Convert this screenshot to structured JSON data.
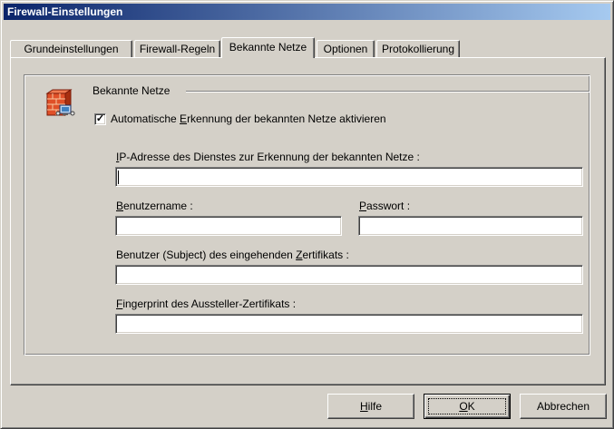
{
  "window": {
    "title": "Firewall-Einstellungen"
  },
  "tabs": [
    {
      "label": "Grundeinstellungen",
      "active": false
    },
    {
      "label": "Firewall-Regeln",
      "active": false
    },
    {
      "label": "Bekannte Netze",
      "active": true
    },
    {
      "label": "Optionen",
      "active": false
    },
    {
      "label": "Protokollierung",
      "active": false
    }
  ],
  "icons": {
    "group": "firewall-brick-wall-network-icon"
  },
  "group": {
    "title": "Bekannte Netze",
    "auto_detect": {
      "label_prefix": "Automatische ",
      "label_hotkey": "E",
      "label_suffix": "rkennung der bekannten Netze aktivieren",
      "checked": true
    },
    "ip_address": {
      "label_hotkey": "I",
      "label_rest": "P-Adresse des Dienstes zur Erkennung der bekannten Netze :",
      "value": ""
    },
    "username": {
      "label_hotkey": "B",
      "label_rest": "enutzername :",
      "value": ""
    },
    "password": {
      "label_hotkey": "P",
      "label_rest": "asswort :",
      "value": ""
    },
    "subject": {
      "label_prefix": "Benutzer (Subject) des eingehenden ",
      "label_hotkey": "Z",
      "label_suffix": "ertifikats :",
      "value": ""
    },
    "fingerprint": {
      "label_hotkey": "F",
      "label_rest": "ingerprint des Aussteller-Zertifikats :",
      "value": ""
    }
  },
  "buttons": {
    "help": {
      "hotkey": "H",
      "rest": "ilfe"
    },
    "ok": {
      "hotkey": "O",
      "rest": "K"
    },
    "cancel": {
      "label": "Abbrechen"
    }
  },
  "colors": {
    "titlebar_start": "#0a246a",
    "titlebar_end": "#a6caf0",
    "face": "#d4d0c8"
  }
}
